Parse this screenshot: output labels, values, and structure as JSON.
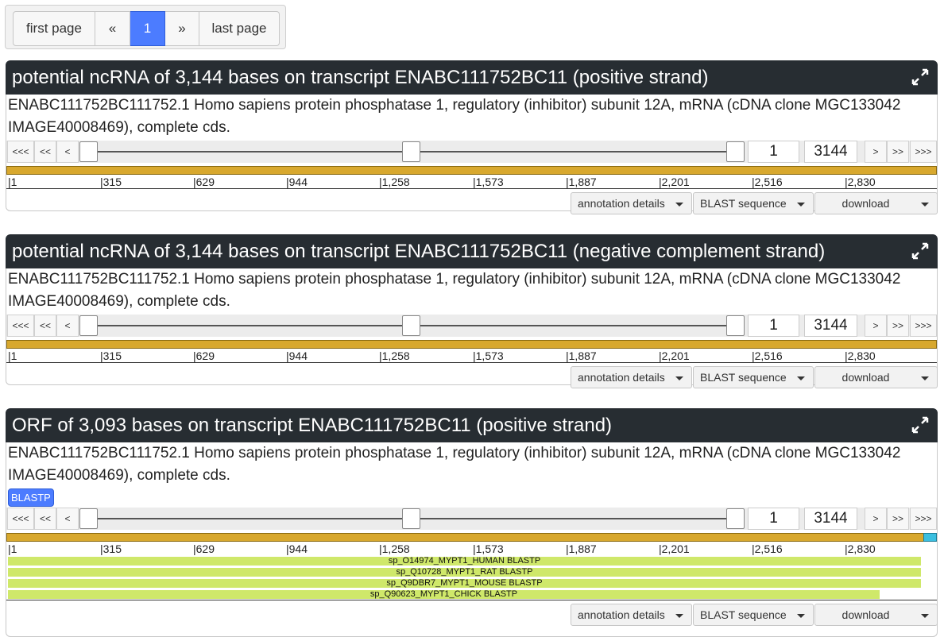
{
  "pager": {
    "first": "first page",
    "prev": "«",
    "current": "1",
    "next": "»",
    "last": "last page"
  },
  "common": {
    "description": "ENABC111752BC111752.1 Homo sapiens protein phosphatase 1, regulatory (inhibitor) subunit 12A, mRNA (cDNA clone MGC133042 IMAGE40008469), complete cds.",
    "nav": {
      "first": "<<<",
      "prev_big": "<<",
      "prev": "<",
      "next": ">",
      "next_big": ">>",
      "last": ">>>"
    },
    "range_start": "1",
    "range_end": "3144",
    "ticks": [
      "|1",
      "|315",
      "|629",
      "|944",
      "|1,258",
      "|1,573",
      "|1,887",
      "|2,201",
      "|2,516",
      "|2,830"
    ],
    "annotation_details": "annotation details",
    "blast_sequence": "BLAST sequence",
    "download": "download"
  },
  "panels": [
    {
      "title": "potential ncRNA of 3,144 bases on transcript ENABC111752BC11 (positive strand)"
    },
    {
      "title": "potential ncRNA of 3,144 bases on transcript ENABC111752BC11 (negative complement strand)"
    },
    {
      "title": "ORF of 3,093 bases on transcript ENABC111752BC11 (positive strand)",
      "badge": "BLASTP",
      "hits": [
        {
          "label": "sp_O14974_MYPT1_HUMAN BLASTP",
          "coverage": 0.985
        },
        {
          "label": "sp_Q10728_MYPT1_RAT BLASTP",
          "coverage": 0.985
        },
        {
          "label": "sp_Q9DBR7_MYPT1_MOUSE BLASTP",
          "coverage": 0.985
        },
        {
          "label": "sp_Q90623_MYPT1_CHICK BLASTP",
          "coverage": 0.94
        }
      ]
    }
  ],
  "colors": {
    "header_bg": "#272d32",
    "active_page": "#4c7cff",
    "gene_bar": "#d8a82e",
    "hit_bar": "#cfe86a",
    "orf_tail": "#3bbfe0"
  }
}
